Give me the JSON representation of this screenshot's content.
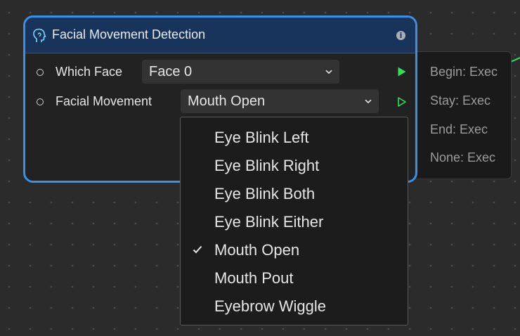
{
  "node": {
    "title": "Facial Movement Detection",
    "params": [
      {
        "label": "Which Face",
        "value": "Face 0"
      },
      {
        "label": "Facial Movement",
        "value": "Mouth Open"
      }
    ]
  },
  "outputs": [
    "Begin: Exec",
    "Stay: Exec",
    "End: Exec",
    "None: Exec"
  ],
  "dropdown": {
    "selected": "Mouth Open",
    "options": [
      "Eye Blink Left",
      "Eye Blink Right",
      "Eye Blink Both",
      "Eye Blink Either",
      "Mouth Open",
      "Mouth Pout",
      "Eyebrow Wiggle"
    ]
  },
  "colors": {
    "accent": "#3a8fe6",
    "header": "#18345a",
    "exec": "#2ee05a"
  }
}
